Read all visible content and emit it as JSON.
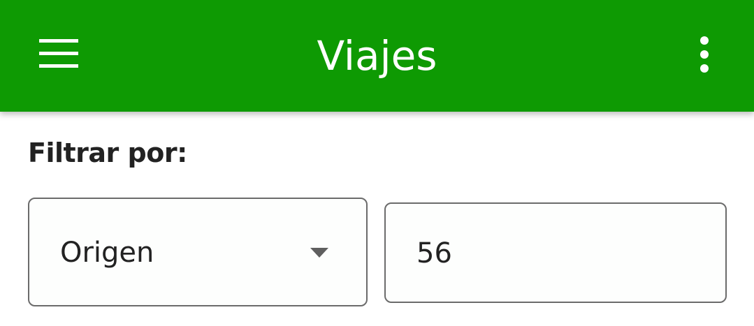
{
  "appbar": {
    "title": "Viajes",
    "background_color": "#0e9a03",
    "menu_icon": "hamburger-menu-icon",
    "more_icon": "more-vertical-icon"
  },
  "filter": {
    "label": "Filtrar por:",
    "field_select": {
      "selected": "Origen",
      "icon": "dropdown-arrow-icon"
    },
    "value_input": {
      "value": "56"
    }
  }
}
